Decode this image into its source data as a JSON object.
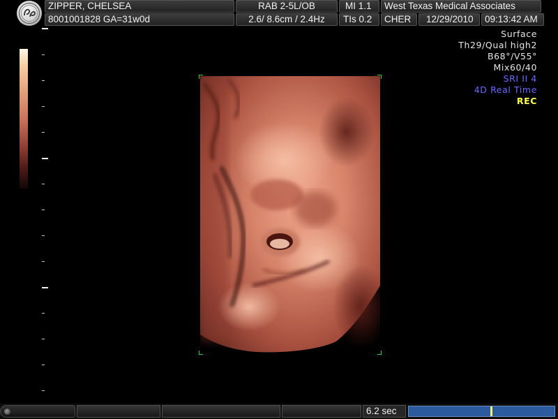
{
  "header": {
    "patient_name": "ZIPPER, CHELSEA",
    "patient_id_ga": "8001001828  GA=31w0d",
    "probe_preset": "RAB 2-5L/OB",
    "depth_freq": "2.6/ 8.6cm / 2.4Hz",
    "mi": "MI  1.1",
    "tis": "TIs  0.2",
    "institution": "West Texas Medical Associates",
    "operator": "CHER",
    "date": "12/29/2010",
    "time": "09:13:42 AM"
  },
  "logo": {
    "icon": "ge-logo-icon"
  },
  "status": {
    "mode": "Surface",
    "quality": "Th29/Qual high2",
    "angles": "B68°/V55°",
    "mix": "Mix60/40",
    "sri": "SRI II 4",
    "realtime": "4D Real Time",
    "rec": "REC"
  },
  "colors": {
    "sri": "#6a6aff",
    "realtime": "#6a6aff",
    "rec": "#ffff4a",
    "roi_corner": "#3ecf3e",
    "cine_bar": "#2b5a9e",
    "cine_marker": "#f6f26a"
  },
  "cine": {
    "duration_label": "6.2 sec",
    "position_fraction": 0.57
  }
}
